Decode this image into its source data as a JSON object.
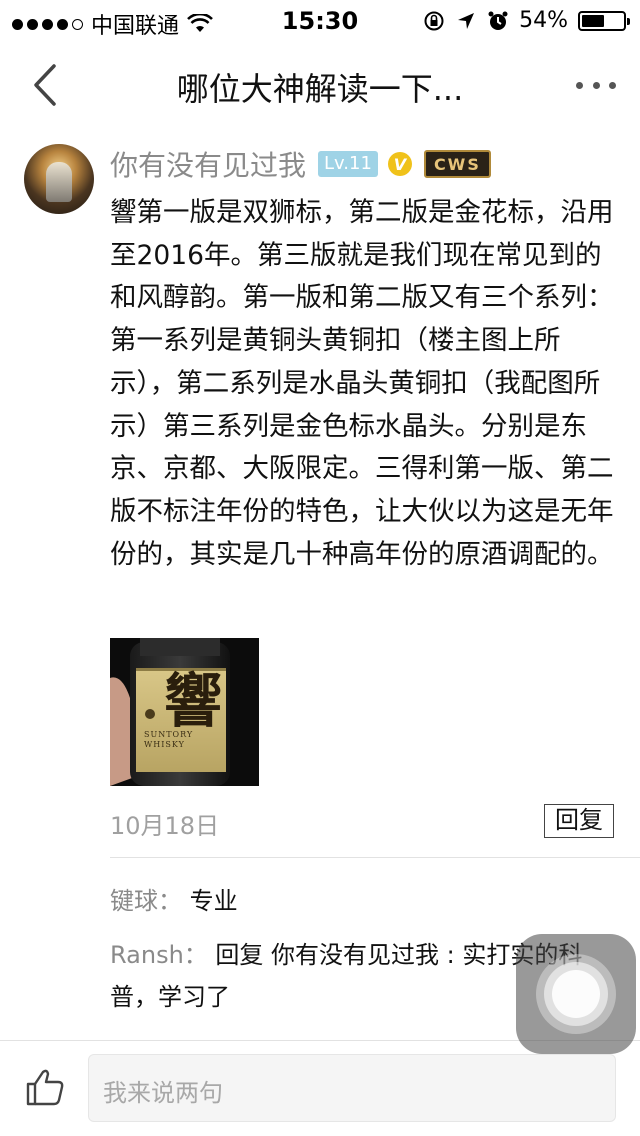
{
  "status_bar": {
    "carrier": "中国联通",
    "time": "15:30",
    "battery_percent": "54%",
    "battery_level": 0.54,
    "signal_bars_filled": 4,
    "signal_bars_total": 5
  },
  "nav": {
    "title": "哪位大神解读一下...",
    "back_icon": "chevron-left-icon",
    "more_icon": "more-dots-icon"
  },
  "post": {
    "author": "你有没有见过我",
    "level": "Lv.11",
    "verified_mark": "V",
    "badge": "CWS",
    "body": "響第一版是双狮标，第二版是金花标，沿用至2016年。第三版就是我们现在常见到的 和风醇韵。第一版和第二版又有三个系列：第一系列是黄铜头黄铜扣（楼主图上所示），第二系列是水晶头黄铜扣（我配图所示）第三系列是金色标水晶头。分别是东京、京都、大阪限定。三得利第一版、第二版不标注年份的特色，让大伙以为这是无年份的，其实是几十种高年份的原酒调配的。",
    "image": {
      "label_kanji": "響",
      "brand_line1": "SUNTORY",
      "brand_line2": "WHISKY"
    },
    "date": "10月18日",
    "reply_label": "回复"
  },
  "comments": [
    {
      "user": "键球：",
      "text": "专业"
    },
    {
      "user": "Ransh：",
      "text": "回复 你有没有见过我 : 实打实的科普，学习了"
    }
  ],
  "bottom_bar": {
    "like_icon": "thumbs-up-icon",
    "input_placeholder": "我来说两句"
  },
  "colors": {
    "level_badge": "#9fd3e6",
    "verified_badge": "#f0c21a",
    "muted_text": "#8a8a8a"
  }
}
